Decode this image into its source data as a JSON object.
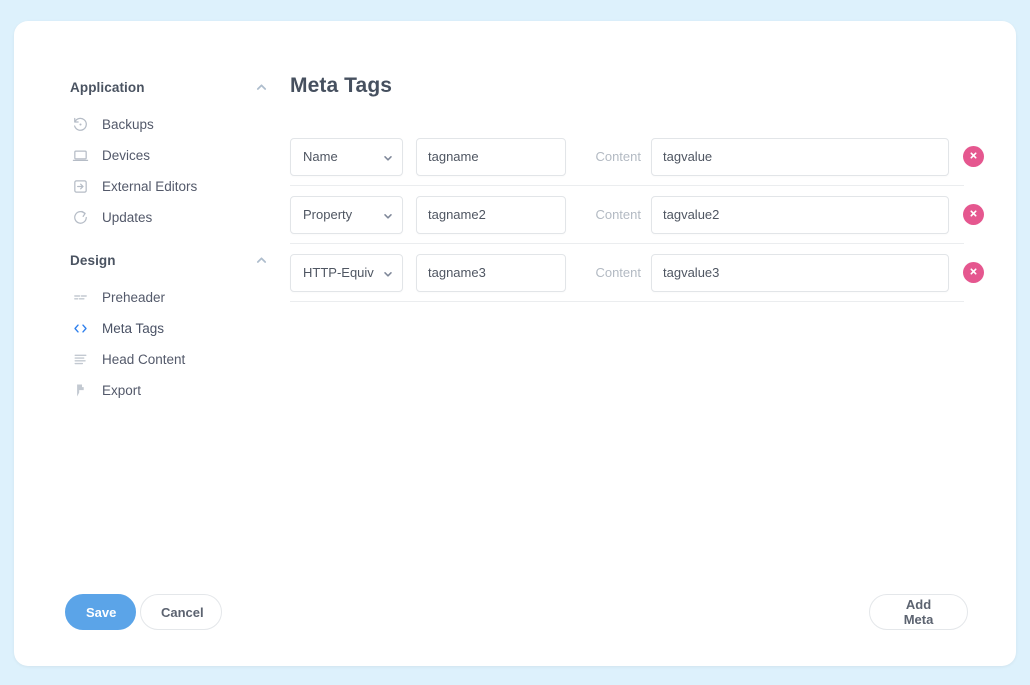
{
  "window": {
    "background_color": "#ddf1fc",
    "card_color": "#ffffff"
  },
  "sidebar": {
    "groups": [
      {
        "title": "Application",
        "collapse_icon": "chevron-up-icon",
        "expanded": true,
        "items": [
          {
            "label": "Backups",
            "icon": "restore-clock-icon",
            "active": false
          },
          {
            "label": "Devices",
            "icon": "laptop-icon",
            "active": false
          },
          {
            "label": "External Editors",
            "icon": "external-link-box-icon",
            "active": false
          },
          {
            "label": "Updates",
            "icon": "refresh-circle-icon",
            "active": false
          }
        ]
      },
      {
        "title": "Design",
        "collapse_icon": "chevron-up-icon",
        "expanded": true,
        "items": [
          {
            "label": "Preheader",
            "icon": "dashed-lines-icon",
            "active": false
          },
          {
            "label": "Meta Tags",
            "icon": "code-brackets-icon",
            "active": true
          },
          {
            "label": "Head Content",
            "icon": "text-lines-icon",
            "active": false
          },
          {
            "label": "Export",
            "icon": "bolt-icon",
            "active": false
          }
        ]
      }
    ]
  },
  "main": {
    "title": "Meta Tags",
    "content_label": "Content",
    "type_options": [
      "Name",
      "Property",
      "HTTP-Equiv"
    ],
    "delete_icon": "close-circle-icon",
    "delete_color": "#e5578f",
    "rows": [
      {
        "type": "Name",
        "name": "tagname",
        "content": "tagvalue"
      },
      {
        "type": "Property",
        "name": "tagname2",
        "content": "tagvalue2"
      },
      {
        "type": "HTTP-Equiv",
        "name": "tagname3",
        "content": "tagvalue3"
      }
    ]
  },
  "footer": {
    "save_label": "Save",
    "cancel_label": "Cancel",
    "add_meta_label": "Add Meta",
    "save_color": "#5ba4e8"
  }
}
